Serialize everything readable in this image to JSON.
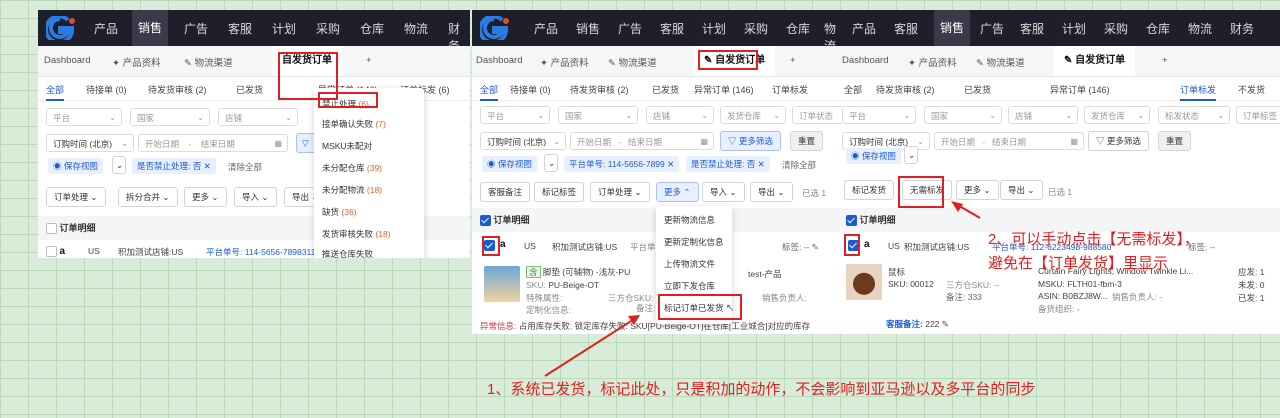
{
  "nav": {
    "items": [
      "产品",
      "销售",
      "广告",
      "客服",
      "计划",
      "采购",
      "仓库",
      "物流",
      "财务"
    ],
    "active": "销售"
  },
  "panel1": {
    "tabs": [
      "Dashboard",
      "产品资料",
      "物流渠道",
      "自发货订单",
      "+"
    ],
    "subtabs": [
      "全部",
      "待接单 (0)",
      "待发货审核 (2)",
      "已发货",
      "异常订单 (146)",
      "订单标发 (6)"
    ],
    "filters": {
      "platform": "平台",
      "country": "国家",
      "store": "店铺",
      "time": "订购时间 (北京)",
      "start": "开始日期",
      "dash": "-",
      "end": "结束日期"
    },
    "save_view": "保存视图",
    "chip": "是否禁止处理: 否",
    "clear": "清除全部",
    "actions": [
      "订单处理",
      "拆分合并",
      "更多",
      "导入",
      "导出"
    ],
    "section": "订单明细",
    "row": {
      "platform": "US",
      "store": "积加测试店铺:US",
      "order": "平台单号: 114-5656-7898311"
    },
    "dropdown": {
      "items": [
        {
          "label": "禁止处理",
          "count": "(6)"
        },
        {
          "label": "接单确认失败",
          "count": "(7)"
        },
        {
          "label": "MSKU未配对",
          "count": ""
        },
        {
          "label": "未分配仓库",
          "count": "(39)"
        },
        {
          "label": "未分配物流",
          "count": "(18)"
        },
        {
          "label": "缺货",
          "count": "(36)"
        },
        {
          "label": "发货审核失败",
          "count": "(18)"
        },
        {
          "label": "推送仓库失败",
          "count": ""
        }
      ]
    }
  },
  "panel2": {
    "tabs": [
      "Dashboard",
      "产品资料",
      "物流渠道",
      "自发货订单",
      "+"
    ],
    "subtabs": [
      "全部",
      "待接单 (0)",
      "待发货审核 (2)",
      "已发货",
      "异常订单 (146)",
      "订单标发"
    ],
    "filters": {
      "platform": "平台",
      "country": "国家",
      "store": "店铺",
      "warehouse": "发货仓库",
      "status": "订单状态",
      "time": "订购时间 (北京)",
      "start": "开始日期",
      "dash": "-",
      "end": "结束日期",
      "more": "更多筛选",
      "reset": "重置"
    },
    "save_view": "保存视图",
    "chip1": "平台单号: 114-5656-7899",
    "chip2": "是否禁止处理: 否",
    "clear": "清除全部",
    "actions": [
      "客服备注",
      "标记标签",
      "订单处理",
      "更多",
      "导入",
      "导出"
    ],
    "selected": "已选 1",
    "section": "订单明细",
    "row": {
      "platform": "US",
      "store": "积加测试店铺:US",
      "order": "平台单号: 114-5656-7899",
      "tag": "标签: --"
    },
    "product": {
      "tag": "含",
      "name": "脚垫 (可辅物) -浅灰-PU",
      "sku_label": "SKU:",
      "sku": "PU-Beige-OT",
      "attr": "特殊属性:",
      "custom": "定制化信息:",
      "third": "三方仓SKU:",
      "note": "备注: --",
      "seller": "销售负责人:",
      "extra": "test-产品"
    },
    "error": {
      "label": "异常信息:",
      "text": "占用库存失败: 锁定库存失败: SKU[PU-Beige-OT]在仓库[工业城合]对应的库存"
    },
    "dropdown": [
      "更新物流信息",
      "更新定制化信息",
      "上传物流文件",
      "立即下发仓库",
      "标记订单已发货"
    ]
  },
  "panel3": {
    "tabs": [
      "Dashboard",
      "产品资料",
      "物流渠道",
      "自发货订单",
      "+"
    ],
    "subtabs": [
      "全部",
      "待发货审核 (2)",
      "已发货",
      "异常订单 (146)",
      "订单标发",
      "不发货"
    ],
    "filters": {
      "platform": "平台",
      "country": "国家",
      "store": "店铺",
      "warehouse": "发货仓库",
      "status": "标发状态",
      "other": "订单标签",
      "time": "订购时间 (北京)",
      "start": "开始日期",
      "dash": "-",
      "end": "结束日期",
      "more": "更多筛选",
      "reset": "重置"
    },
    "save_view": "保存视图",
    "actions": [
      "标记发货",
      "无需标发",
      "更多",
      "导出"
    ],
    "selected": "已选 1",
    "section": "订单明细",
    "row": {
      "platform": "US",
      "store": "积加测试店铺:US",
      "order": "平台单号: 112-6223498-988580",
      "tag": "标签: --"
    },
    "product": {
      "name": "鼠标",
      "sku": "SKU: 00012",
      "qty": "备注: 333",
      "third": "三方仓SKU: --",
      "title": "Curtain Fairy Lights, Window Twinkle Li...",
      "msku": "MSKU: FLTH01-fbm-3",
      "asin": "ASIN: B0BZJ8W...",
      "seller": "销售负责人: -",
      "source": "备货组织: -",
      "note_label": "客服备注:",
      "note_val": "222"
    },
    "right_col": [
      "应发: 1",
      "未发: 0",
      "已发: 1"
    ]
  },
  "annotations": {
    "a1": "1、系统已发货，标记此处，只是积加的动作，不会影响到亚马逊以及多平台的同步",
    "a2_line1": "2、可以手动点击【无需标发】，",
    "a2_line2": "避免在【订单发货】里显示"
  },
  "colors": {
    "accent": "#1a5bd9",
    "annotation": "#e02020",
    "nav_bg": "#1f1f2b"
  }
}
